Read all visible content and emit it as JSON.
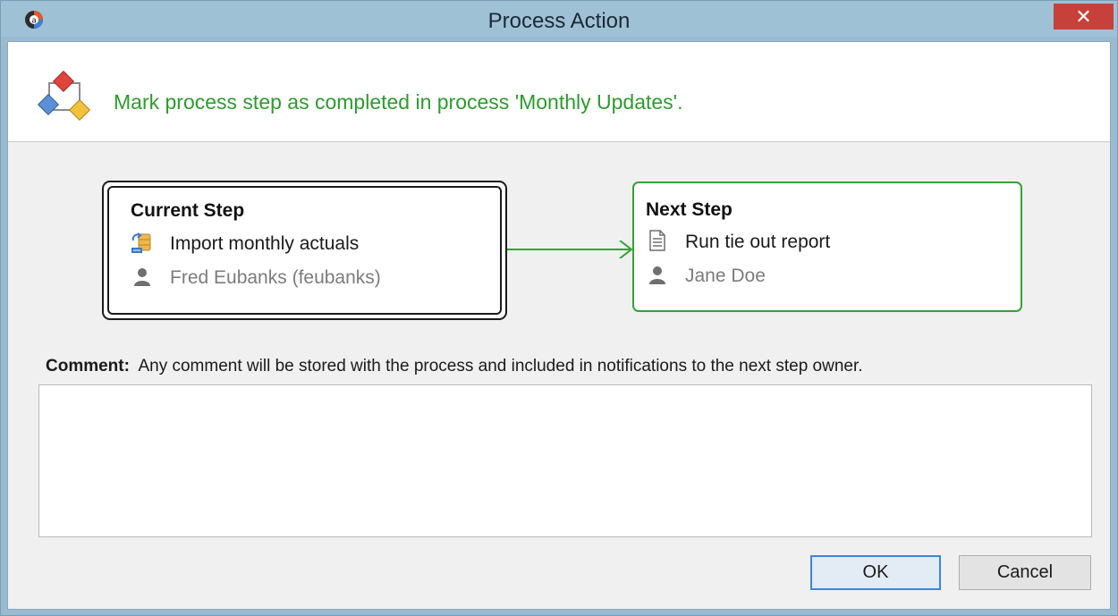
{
  "window": {
    "title": "Process Action",
    "close_label": "✕"
  },
  "header": {
    "message": "Mark process step as completed in process 'Monthly Updates'."
  },
  "current_step": {
    "heading": "Current Step",
    "task": "Import monthly actuals",
    "owner": "Fred Eubanks (feubanks)"
  },
  "next_step": {
    "heading": "Next Step",
    "task": "Run tie out report",
    "owner": "Jane Doe"
  },
  "comment": {
    "label": "Comment:",
    "hint": "Any comment will be stored with the process and included in notifications to the next step owner.",
    "value": ""
  },
  "buttons": {
    "ok": "OK",
    "cancel": "Cancel"
  },
  "colors": {
    "accent_green": "#2e9a2e",
    "close_red": "#c7403a",
    "titlebar": "#9fc1d6"
  }
}
